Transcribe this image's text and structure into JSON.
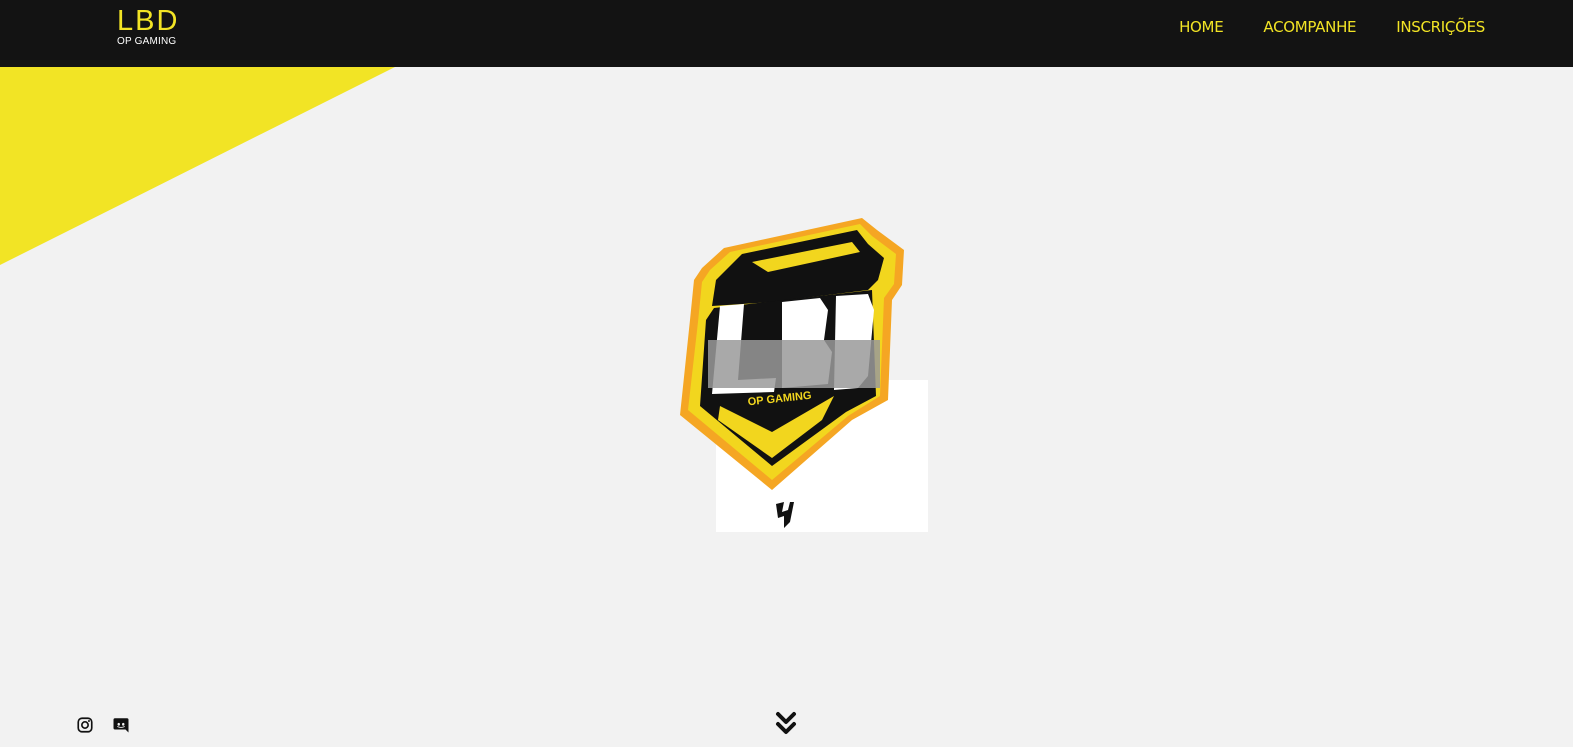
{
  "colors": {
    "accent": "#f2e425",
    "header_bg": "#131313",
    "page_bg": "#f2f2f2",
    "logo_orange": "#f5a623"
  },
  "brand": {
    "title": "LBD",
    "subtitle": "OP GAMING"
  },
  "nav": {
    "items": [
      {
        "label": "HOME"
      },
      {
        "label": "ACOMPANHE"
      },
      {
        "label": "INSCRIÇÕES"
      }
    ]
  },
  "hero": {
    "logo_text": "LBD",
    "logo_subtext": "OP GAMING",
    "logo_icon": "lbd-shield-logo"
  },
  "socials": {
    "items": [
      {
        "icon": "instagram-icon"
      },
      {
        "icon": "discord-icon"
      }
    ]
  },
  "scroll": {
    "icon": "double-chevron-down-icon"
  }
}
